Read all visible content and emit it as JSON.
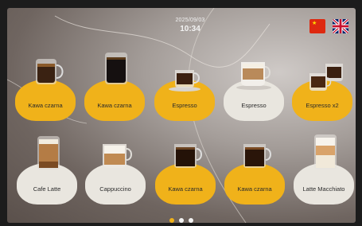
{
  "status": {
    "date": "2025/09/03",
    "time": "10:34"
  },
  "languages": [
    {
      "name": "chinese-flag"
    },
    {
      "name": "uk-flag"
    }
  ],
  "drinks": [
    {
      "label": "Kawa czarna",
      "plate": "yellow",
      "cup": "glass-mug"
    },
    {
      "label": "Kawa czarna",
      "plate": "yellow",
      "cup": "tall-glass"
    },
    {
      "label": "Espresso",
      "plate": "yellow",
      "cup": "small-cup"
    },
    {
      "label": "Espresso",
      "plate": "white",
      "cup": "cream-cup"
    },
    {
      "label": "Espresso x2",
      "plate": "yellow",
      "cup": "double-cup"
    },
    {
      "label": "Cafe Latte",
      "plate": "white",
      "cup": "latte-glass"
    },
    {
      "label": "Cappuccino",
      "plate": "white",
      "cup": "foam-cup"
    },
    {
      "label": "Kawa czarna",
      "plate": "yellow",
      "cup": "glass-mug"
    },
    {
      "label": "Kawa czarna",
      "plate": "yellow",
      "cup": "glass-mug"
    },
    {
      "label": "Latte Macchiato",
      "plate": "white",
      "cup": "macchiato-glass"
    }
  ],
  "pagination": {
    "pages": 3,
    "current": 1
  },
  "colors": {
    "accent_yellow": "#f0b21a",
    "plate_white": "#e9e6df",
    "active_dot": "#f0b21a"
  }
}
